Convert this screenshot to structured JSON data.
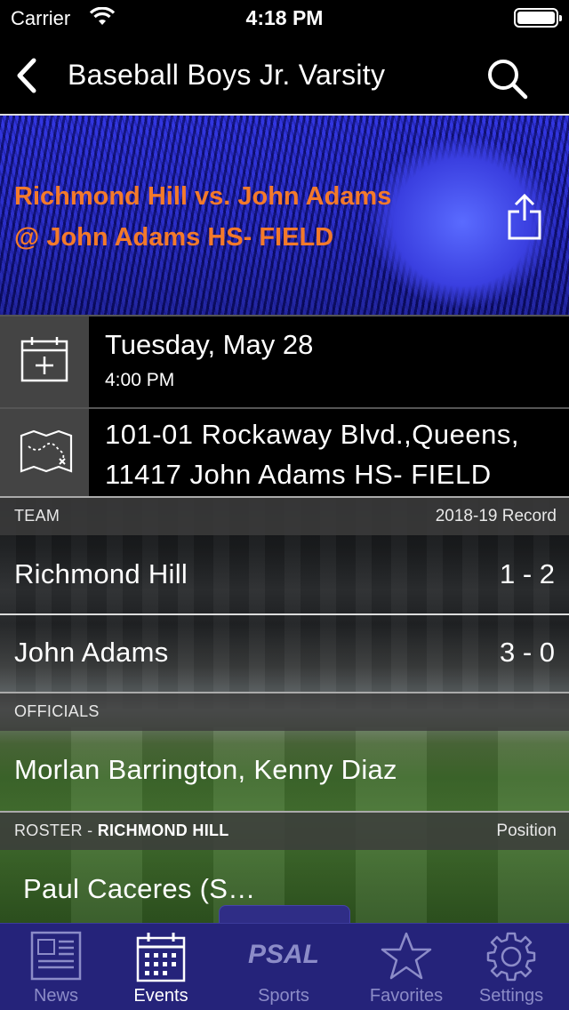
{
  "status_bar": {
    "carrier": "Carrier",
    "time": "4:18 PM"
  },
  "nav": {
    "title": "Baseball Boys Jr. Varsity"
  },
  "game": {
    "matchup_line1": "Richmond Hill vs. John Adams",
    "matchup_line2": "@ John Adams HS- FIELD",
    "date": "Tuesday, May 28",
    "time": "4:00 PM",
    "address_line1": "101-01 Rockaway Blvd.,Queens,",
    "address_line2": "11417 John Adams HS- FIELD"
  },
  "team_section": {
    "header_left": "TEAM",
    "header_right": "2018-19 Record",
    "teams": [
      {
        "name": "Richmond Hill",
        "record": "1 - 2"
      },
      {
        "name": "John Adams",
        "record": "3 - 0"
      }
    ]
  },
  "officials_section": {
    "header": "OFFICIALS",
    "names": "Morlan Barrington, Kenny Diaz"
  },
  "roster_section": {
    "header_prefix": "ROSTER - ",
    "header_team": "RICHMOND HILL",
    "header_right": "Position",
    "players": [
      {
        "name": "Paul Caceres (S…"
      }
    ]
  },
  "tabs": [
    {
      "label": "News",
      "icon": "newspaper-icon",
      "active": false
    },
    {
      "label": "Events",
      "icon": "calendar-icon",
      "active": true
    },
    {
      "label": "Sports",
      "icon": "psal-logo-icon",
      "active": false
    },
    {
      "label": "Favorites",
      "icon": "star-icon",
      "active": false
    },
    {
      "label": "Settings",
      "icon": "gear-icon",
      "active": false
    }
  ],
  "logo_text": "PSAL",
  "colors": {
    "accent_orange": "#f47a2a",
    "tab_bar": "#25237a",
    "hero_blue": "#2a2ad6"
  }
}
